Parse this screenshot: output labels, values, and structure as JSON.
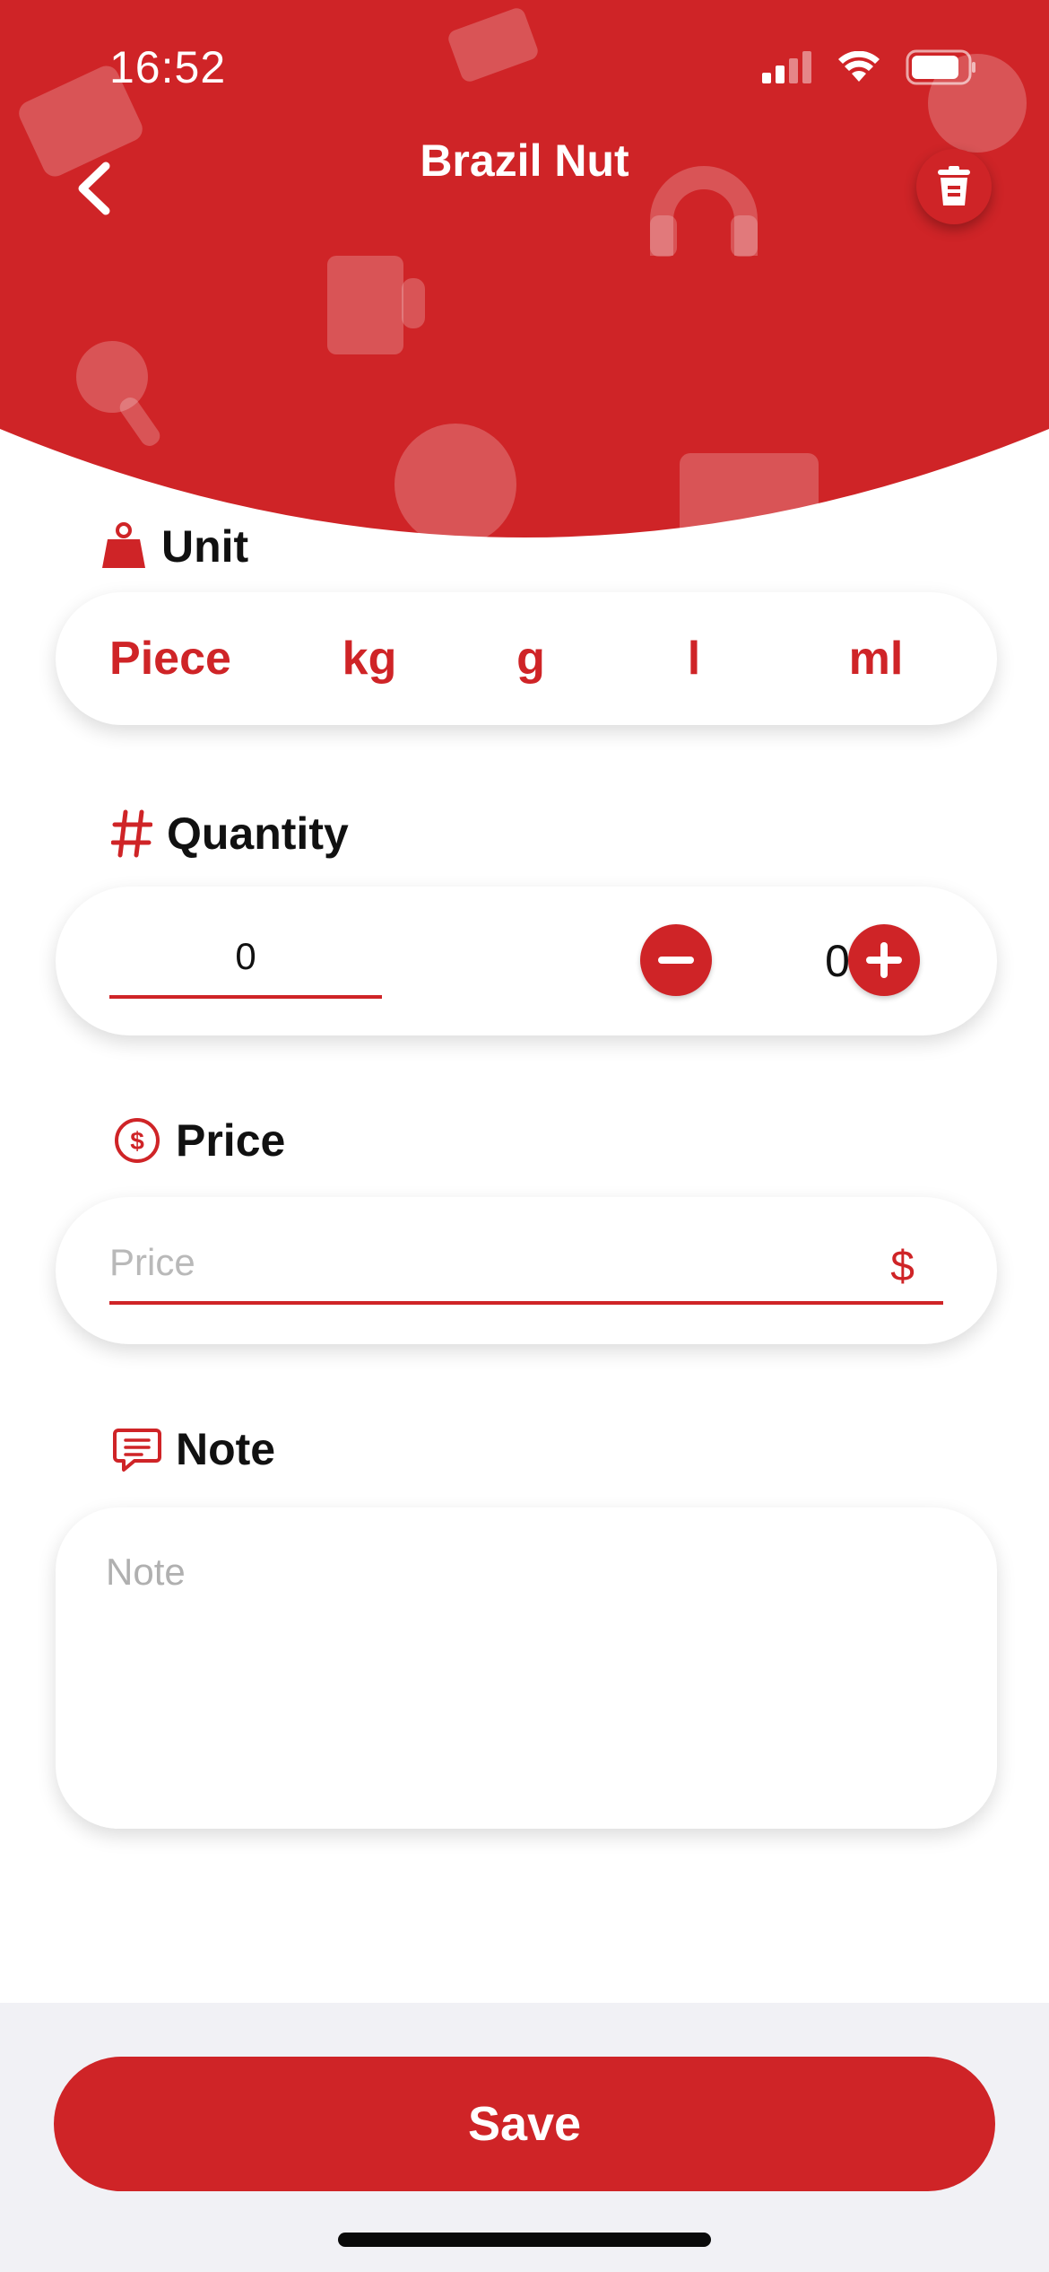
{
  "status_bar": {
    "time": "16:52"
  },
  "header": {
    "title": "Brazil Nut"
  },
  "unit": {
    "label": "Unit",
    "options": [
      "Piece",
      "kg",
      "g",
      "l",
      "ml"
    ]
  },
  "quantity": {
    "label": "Quantity",
    "input_value": "0",
    "stepper_value": "0"
  },
  "price": {
    "label": "Price",
    "placeholder": "Price",
    "currency": "$"
  },
  "note": {
    "label": "Note",
    "placeholder": "Note"
  },
  "footer": {
    "save_label": "Save"
  },
  "colors": {
    "accent": "#cf2427",
    "footer_bg": "#f1f1f5"
  }
}
